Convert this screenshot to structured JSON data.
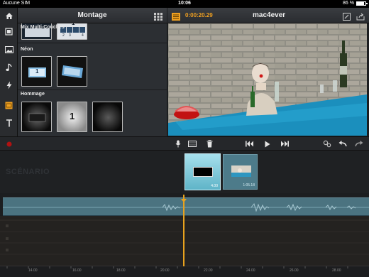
{
  "status_bar": {
    "carrier": "Aucune SIM",
    "time": "10:06",
    "battery_text": "86 %",
    "battery_level": 0.86
  },
  "sidebar": {
    "tools": [
      {
        "icon": "home-icon"
      },
      {
        "icon": "film-icon"
      },
      {
        "icon": "photo-icon"
      },
      {
        "icon": "music-note-icon"
      },
      {
        "icon": "lightning-icon"
      },
      {
        "icon": "transitions-icon"
      },
      {
        "icon": "text-icon"
      }
    ],
    "record": {
      "icon": "record-icon"
    }
  },
  "library": {
    "title": "Montage",
    "sections": [
      {
        "label": "Mix Multi-Couches"
      },
      {
        "label": "Néon"
      },
      {
        "label": "Hommage"
      }
    ],
    "thumb_text": {
      "number_1": "1",
      "number_2": "2",
      "number_3": "3",
      "number_4": "4"
    }
  },
  "header": {
    "timecode": "0:00:20.29",
    "project_title": "mac4ever"
  },
  "controls": {
    "icons": [
      "microphone-icon",
      "film-strip-icon",
      "trash-icon",
      "skip-back-icon",
      "play-icon",
      "skip-forward-icon",
      "settings-icon",
      "undo-icon",
      "redo-icon"
    ]
  },
  "scenario": {
    "label": "SCÉNARIO",
    "clips": [
      {
        "duration": "4.00"
      },
      {
        "duration": "1:05.18"
      }
    ]
  },
  "timeline": {
    "ticks": [
      "14.00",
      "16.00",
      "18.00",
      "20.00",
      "22.00",
      "24.00",
      "26.00",
      "28.00"
    ]
  },
  "colors": {
    "accent": "#f0a020",
    "audio_track": "#4b7380",
    "selected_clip": "#7cc6d8"
  }
}
